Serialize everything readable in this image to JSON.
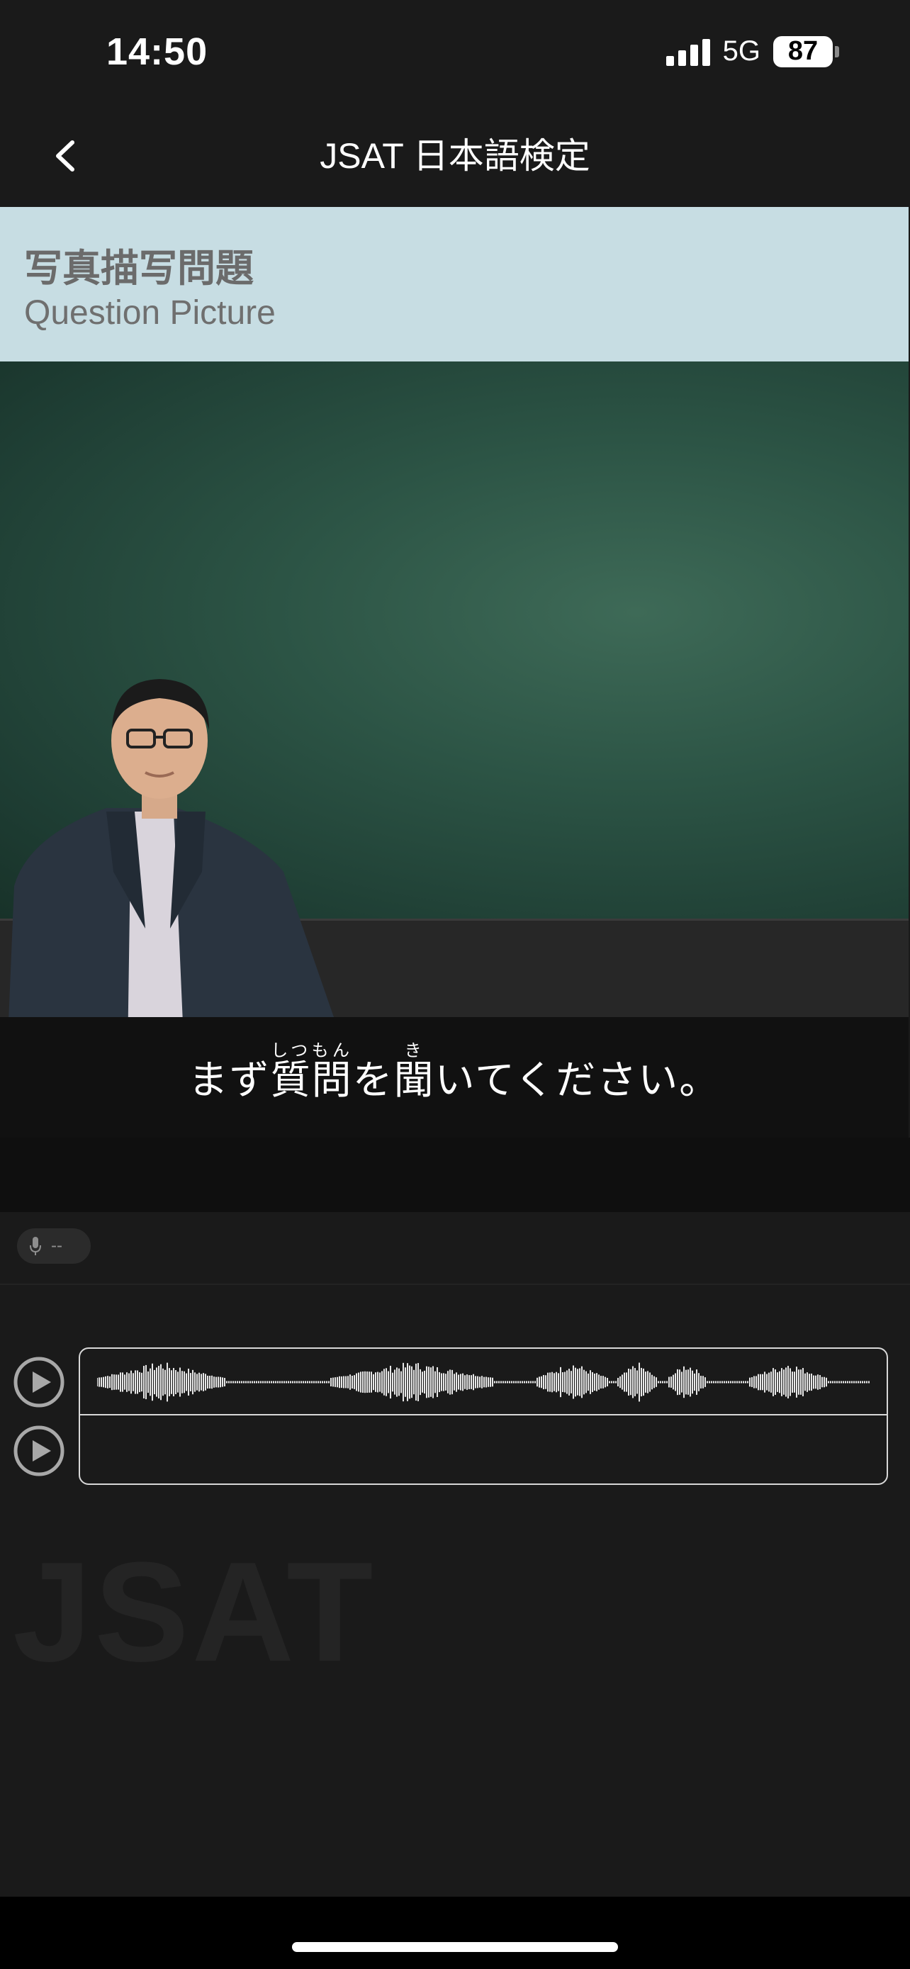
{
  "status_bar": {
    "time": "14:50",
    "network": "5G",
    "battery": "87"
  },
  "nav": {
    "title": "JSAT 日本語検定",
    "back_icon": "chevron-left-icon"
  },
  "section": {
    "title_jp": "写真描写問題",
    "title_en": "Question Picture"
  },
  "subtitle": {
    "part1": "まず",
    "kanji1": "質問",
    "ruby1": "しつもん",
    "part2": "を",
    "kanji2": "聞",
    "ruby2": "き",
    "part3": "いてください。"
  },
  "recorder": {
    "mic_icon": "microphone-icon",
    "value": "--"
  },
  "audio": {
    "play_icon": "play-circle-icon"
  },
  "watermark": "JSAT",
  "colors": {
    "header_bg": "#c7dde3",
    "chalkboard": "#2c5445",
    "background": "#1a1a1a"
  }
}
